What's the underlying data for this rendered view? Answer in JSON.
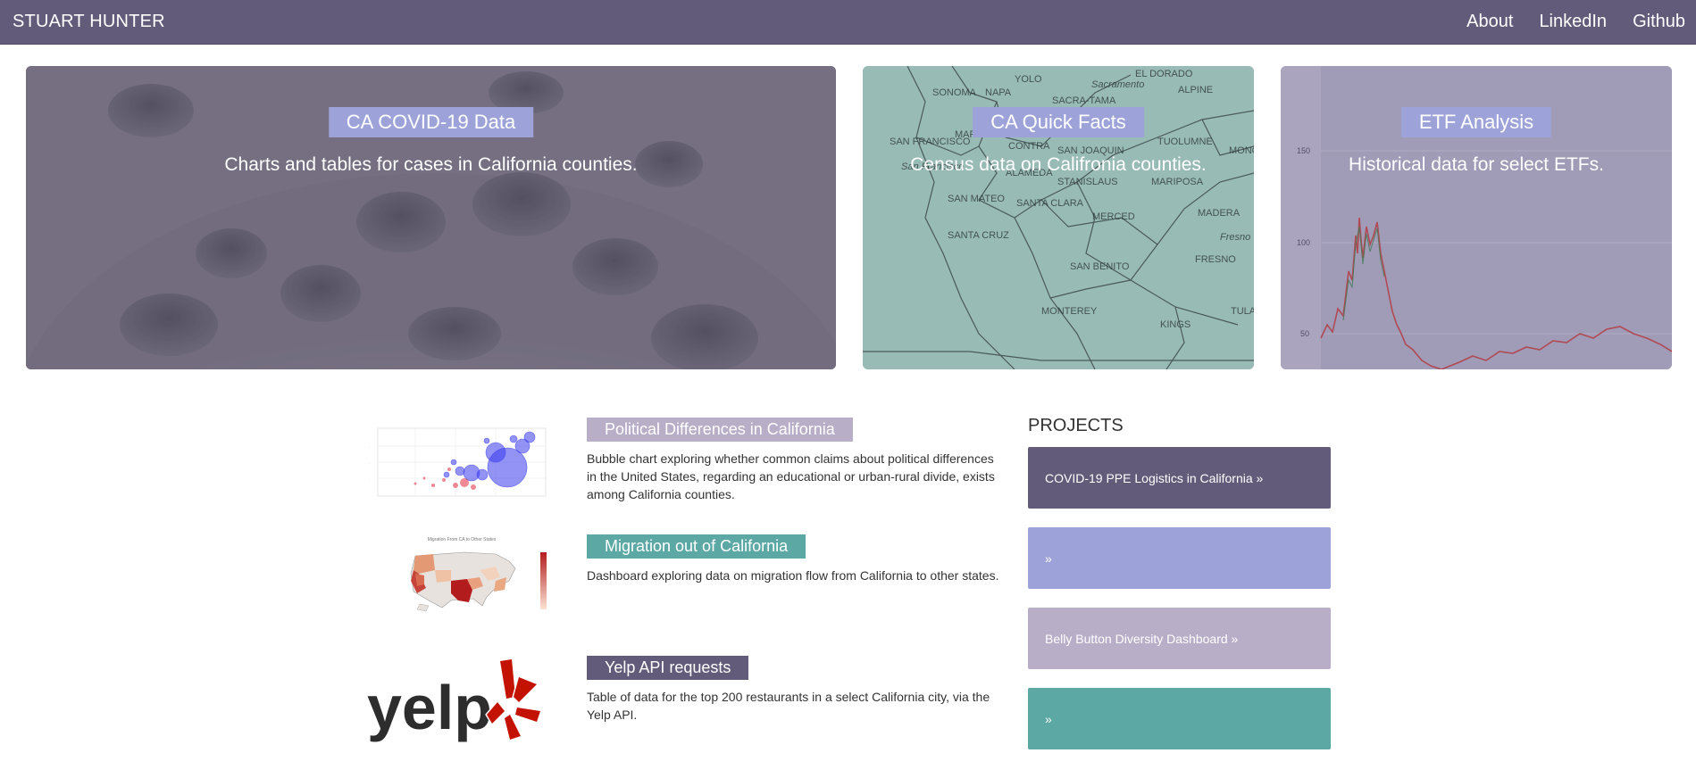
{
  "navbar": {
    "brand": "STUART HUNTER",
    "links": [
      {
        "label": "About"
      },
      {
        "label": "LinkedIn"
      },
      {
        "label": "Github"
      }
    ],
    "color": "#625b7a"
  },
  "hero_cards": [
    {
      "title": "CA COVID-19 Data",
      "description": "Charts and tables for cases in California counties.",
      "image": "coronavirus-photo",
      "title_bg": "#9da3d8"
    },
    {
      "title": "CA Quick Facts",
      "description": "Census data on Califronia counties.",
      "image": "california-county-map",
      "title_bg": "#9da3d8",
      "map_labels": [
        "SONOMA",
        "NAPA",
        "YOLO",
        "EL DORADO",
        "Sacramento",
        "SACRA-TAMA",
        "ALPINE",
        "SAN FRANCISCO",
        "San Francisco",
        "MARIN",
        "CONTRA",
        "SAN JOAQUIN",
        "TUOLUMNE",
        "MONO",
        "ALAMEDA",
        "STANISLAUS",
        "MARIPOSA",
        "SAN MATEO",
        "SANTA CLARA",
        "MERCED",
        "MADERA",
        "SANTA CRUZ",
        "Fresno",
        "FRESNO",
        "SAN BENITO",
        "MONTEREY",
        "KINGS",
        "TULA"
      ]
    },
    {
      "title": "ETF Analysis",
      "description": "Historical data for select ETFs.",
      "image": "etf-price-chart",
      "title_bg": "#9da3d8",
      "axis_ticks": [
        "150",
        "100",
        "50"
      ]
    }
  ],
  "featured": [
    {
      "title": "Political Differences in California",
      "description": "Bubble chart exploring whether common claims about political differences in the United States, regarding an educational or urban-rural divide, exists among California counties.",
      "thumbnail": "bubble-chart-thumbnail",
      "title_bg": "#b8aec8"
    },
    {
      "title": "Migration out of California",
      "description": "Dashboard exploring data on migration flow from California to other states.",
      "thumbnail": "us-migration-map-thumbnail",
      "title_bg": "#5ba8a5",
      "thumbnail_caption": "Migration From CA to Other States"
    },
    {
      "title": "Yelp API requests",
      "description": "Table of data for the top 200 restaurants in a select California city, via the Yelp API.",
      "thumbnail": "yelp-logo",
      "title_bg": "#625b7a",
      "logo_text": "yelp"
    }
  ],
  "projects": {
    "heading": "PROJECTS",
    "items": [
      {
        "label": "COVID-19 PPE Logistics in California »",
        "bg": "#625b7a"
      },
      {
        "label": "»",
        "bg": "#9da3d8"
      },
      {
        "label": "Belly Button Diversity Dashboard »",
        "bg": "#b8aec8"
      },
      {
        "label": "»",
        "bg": "#5ba8a5"
      }
    ]
  }
}
